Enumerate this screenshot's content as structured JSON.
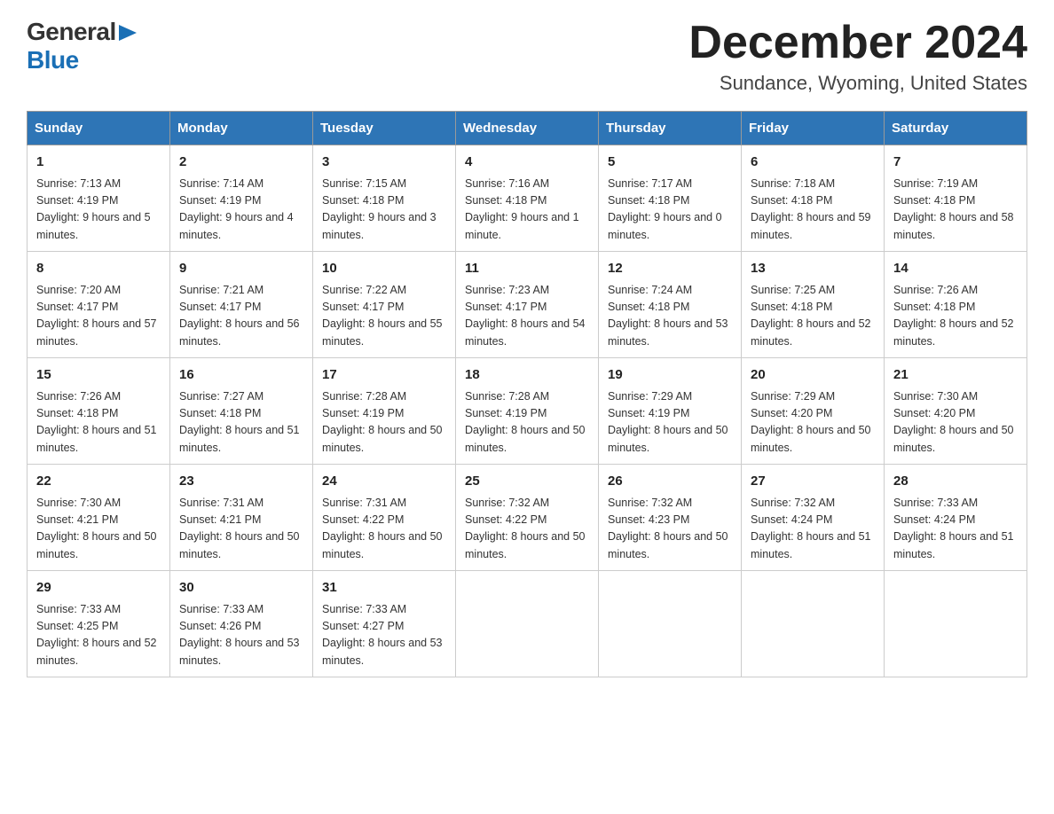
{
  "header": {
    "logo_line1": "General",
    "logo_flag": "▶",
    "logo_line2": "Blue",
    "month_title": "December 2024",
    "location": "Sundance, Wyoming, United States"
  },
  "weekdays": [
    "Sunday",
    "Monday",
    "Tuesday",
    "Wednesday",
    "Thursday",
    "Friday",
    "Saturday"
  ],
  "weeks": [
    [
      {
        "day": "1",
        "sunrise": "Sunrise: 7:13 AM",
        "sunset": "Sunset: 4:19 PM",
        "daylight": "Daylight: 9 hours and 5 minutes."
      },
      {
        "day": "2",
        "sunrise": "Sunrise: 7:14 AM",
        "sunset": "Sunset: 4:19 PM",
        "daylight": "Daylight: 9 hours and 4 minutes."
      },
      {
        "day": "3",
        "sunrise": "Sunrise: 7:15 AM",
        "sunset": "Sunset: 4:18 PM",
        "daylight": "Daylight: 9 hours and 3 minutes."
      },
      {
        "day": "4",
        "sunrise": "Sunrise: 7:16 AM",
        "sunset": "Sunset: 4:18 PM",
        "daylight": "Daylight: 9 hours and 1 minute."
      },
      {
        "day": "5",
        "sunrise": "Sunrise: 7:17 AM",
        "sunset": "Sunset: 4:18 PM",
        "daylight": "Daylight: 9 hours and 0 minutes."
      },
      {
        "day": "6",
        "sunrise": "Sunrise: 7:18 AM",
        "sunset": "Sunset: 4:18 PM",
        "daylight": "Daylight: 8 hours and 59 minutes."
      },
      {
        "day": "7",
        "sunrise": "Sunrise: 7:19 AM",
        "sunset": "Sunset: 4:18 PM",
        "daylight": "Daylight: 8 hours and 58 minutes."
      }
    ],
    [
      {
        "day": "8",
        "sunrise": "Sunrise: 7:20 AM",
        "sunset": "Sunset: 4:17 PM",
        "daylight": "Daylight: 8 hours and 57 minutes."
      },
      {
        "day": "9",
        "sunrise": "Sunrise: 7:21 AM",
        "sunset": "Sunset: 4:17 PM",
        "daylight": "Daylight: 8 hours and 56 minutes."
      },
      {
        "day": "10",
        "sunrise": "Sunrise: 7:22 AM",
        "sunset": "Sunset: 4:17 PM",
        "daylight": "Daylight: 8 hours and 55 minutes."
      },
      {
        "day": "11",
        "sunrise": "Sunrise: 7:23 AM",
        "sunset": "Sunset: 4:17 PM",
        "daylight": "Daylight: 8 hours and 54 minutes."
      },
      {
        "day": "12",
        "sunrise": "Sunrise: 7:24 AM",
        "sunset": "Sunset: 4:18 PM",
        "daylight": "Daylight: 8 hours and 53 minutes."
      },
      {
        "day": "13",
        "sunrise": "Sunrise: 7:25 AM",
        "sunset": "Sunset: 4:18 PM",
        "daylight": "Daylight: 8 hours and 52 minutes."
      },
      {
        "day": "14",
        "sunrise": "Sunrise: 7:26 AM",
        "sunset": "Sunset: 4:18 PM",
        "daylight": "Daylight: 8 hours and 52 minutes."
      }
    ],
    [
      {
        "day": "15",
        "sunrise": "Sunrise: 7:26 AM",
        "sunset": "Sunset: 4:18 PM",
        "daylight": "Daylight: 8 hours and 51 minutes."
      },
      {
        "day": "16",
        "sunrise": "Sunrise: 7:27 AM",
        "sunset": "Sunset: 4:18 PM",
        "daylight": "Daylight: 8 hours and 51 minutes."
      },
      {
        "day": "17",
        "sunrise": "Sunrise: 7:28 AM",
        "sunset": "Sunset: 4:19 PM",
        "daylight": "Daylight: 8 hours and 50 minutes."
      },
      {
        "day": "18",
        "sunrise": "Sunrise: 7:28 AM",
        "sunset": "Sunset: 4:19 PM",
        "daylight": "Daylight: 8 hours and 50 minutes."
      },
      {
        "day": "19",
        "sunrise": "Sunrise: 7:29 AM",
        "sunset": "Sunset: 4:19 PM",
        "daylight": "Daylight: 8 hours and 50 minutes."
      },
      {
        "day": "20",
        "sunrise": "Sunrise: 7:29 AM",
        "sunset": "Sunset: 4:20 PM",
        "daylight": "Daylight: 8 hours and 50 minutes."
      },
      {
        "day": "21",
        "sunrise": "Sunrise: 7:30 AM",
        "sunset": "Sunset: 4:20 PM",
        "daylight": "Daylight: 8 hours and 50 minutes."
      }
    ],
    [
      {
        "day": "22",
        "sunrise": "Sunrise: 7:30 AM",
        "sunset": "Sunset: 4:21 PM",
        "daylight": "Daylight: 8 hours and 50 minutes."
      },
      {
        "day": "23",
        "sunrise": "Sunrise: 7:31 AM",
        "sunset": "Sunset: 4:21 PM",
        "daylight": "Daylight: 8 hours and 50 minutes."
      },
      {
        "day": "24",
        "sunrise": "Sunrise: 7:31 AM",
        "sunset": "Sunset: 4:22 PM",
        "daylight": "Daylight: 8 hours and 50 minutes."
      },
      {
        "day": "25",
        "sunrise": "Sunrise: 7:32 AM",
        "sunset": "Sunset: 4:22 PM",
        "daylight": "Daylight: 8 hours and 50 minutes."
      },
      {
        "day": "26",
        "sunrise": "Sunrise: 7:32 AM",
        "sunset": "Sunset: 4:23 PM",
        "daylight": "Daylight: 8 hours and 50 minutes."
      },
      {
        "day": "27",
        "sunrise": "Sunrise: 7:32 AM",
        "sunset": "Sunset: 4:24 PM",
        "daylight": "Daylight: 8 hours and 51 minutes."
      },
      {
        "day": "28",
        "sunrise": "Sunrise: 7:33 AM",
        "sunset": "Sunset: 4:24 PM",
        "daylight": "Daylight: 8 hours and 51 minutes."
      }
    ],
    [
      {
        "day": "29",
        "sunrise": "Sunrise: 7:33 AM",
        "sunset": "Sunset: 4:25 PM",
        "daylight": "Daylight: 8 hours and 52 minutes."
      },
      {
        "day": "30",
        "sunrise": "Sunrise: 7:33 AM",
        "sunset": "Sunset: 4:26 PM",
        "daylight": "Daylight: 8 hours and 53 minutes."
      },
      {
        "day": "31",
        "sunrise": "Sunrise: 7:33 AM",
        "sunset": "Sunset: 4:27 PM",
        "daylight": "Daylight: 8 hours and 53 minutes."
      },
      null,
      null,
      null,
      null
    ]
  ]
}
